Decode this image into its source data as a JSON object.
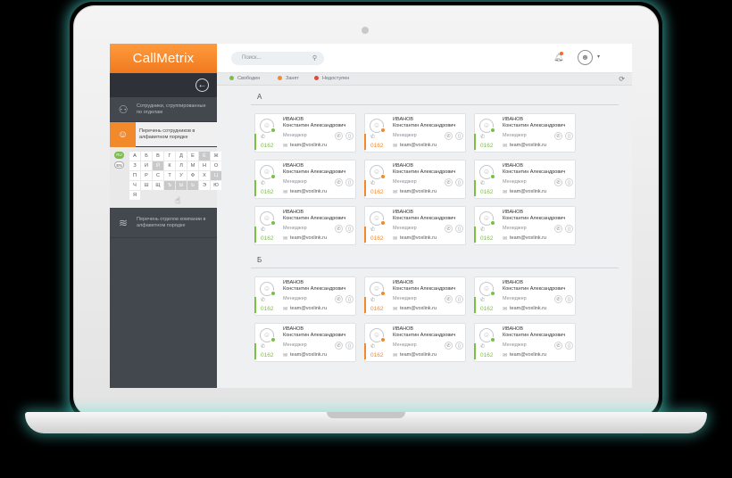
{
  "app": {
    "logo": "CallMetrix"
  },
  "colors": {
    "accent": "#f28a2c",
    "free": "#79c043",
    "busy": "#f28a2c",
    "unavailable": "#d94b3c"
  },
  "sidebar": {
    "back_icon": "arrow-left-icon",
    "items": [
      {
        "label": "Сотрудники, сгруппированные по отделам",
        "icon": "users-icon"
      },
      {
        "label": "Перечень сотрудников в алфавитном порядке",
        "icon": "user-list-icon"
      },
      {
        "label": "Перечень отделов компании в алфавитном порядке",
        "icon": "layers-icon"
      }
    ],
    "lang": {
      "ru": "RU",
      "en": "EN"
    },
    "letters": [
      "А",
      "Б",
      "В",
      "Г",
      "Д",
      "Е",
      "Ё",
      "Ж",
      "З",
      "И",
      "Й",
      "К",
      "Л",
      "М",
      "Н",
      "О",
      "П",
      "Р",
      "С",
      "Т",
      "У",
      "Ф",
      "Х",
      "Ц",
      "Ч",
      "Ш",
      "Щ",
      "Ъ",
      "Ы",
      "Ь",
      "Э",
      "Ю",
      "Я"
    ]
  },
  "topbar": {
    "search_placeholder": "Поиск..."
  },
  "statusbar": {
    "free": "Свободен",
    "busy": "Занят",
    "unavailable": "Недоступен"
  },
  "sections": [
    {
      "letter": "А",
      "cards": [
        {
          "surname": "ИВАНОВ",
          "name": "Константин Александрович",
          "role": "Менеджер",
          "email": "team@voxlink.ru",
          "ext": "0162",
          "status": "free"
        },
        {
          "surname": "ИВАНОВ",
          "name": "Константин Александрович",
          "role": "Менеджер",
          "email": "team@voxlink.ru",
          "ext": "0162",
          "status": "busy"
        },
        {
          "surname": "ИВАНОВ",
          "name": "Константин Александрович",
          "role": "Менеджер",
          "email": "team@voxlink.ru",
          "ext": "0162",
          "status": "free"
        },
        {
          "surname": "ИВАНОВ",
          "name": "Константин Александрович",
          "role": "Менеджер",
          "email": "team@voxlink.ru",
          "ext": "0162",
          "status": "free"
        },
        {
          "surname": "ИВАНОВ",
          "name": "Константин Александрович",
          "role": "Менеджер",
          "email": "team@voxlink.ru",
          "ext": "0162",
          "status": "busy"
        },
        {
          "surname": "ИВАНОВ",
          "name": "Константин Александрович",
          "role": "Менеджер",
          "email": "team@voxlink.ru",
          "ext": "0162",
          "status": "free"
        },
        {
          "surname": "ИВАНОВ",
          "name": "Константин Александрович",
          "role": "Менеджер",
          "email": "team@voxlink.ru",
          "ext": "0162",
          "status": "free"
        },
        {
          "surname": "ИВАНОВ",
          "name": "Константин Александрович",
          "role": "Менеджер",
          "email": "team@voxlink.ru",
          "ext": "0162",
          "status": "busy"
        },
        {
          "surname": "ИВАНОВ",
          "name": "Константин Александрович",
          "role": "Менеджер",
          "email": "team@voxlink.ru",
          "ext": "0162",
          "status": "free"
        }
      ]
    },
    {
      "letter": "Б",
      "cards": [
        {
          "surname": "ИВАНОВ",
          "name": "Константин Александрович",
          "role": "Менеджер",
          "email": "team@voxlink.ru",
          "ext": "0162",
          "status": "free"
        },
        {
          "surname": "ИВАНОВ",
          "name": "Константин Александрович",
          "role": "Менеджер",
          "email": "team@voxlink.ru",
          "ext": "0162",
          "status": "busy"
        },
        {
          "surname": "ИВАНОВ",
          "name": "Константин Александрович",
          "role": "Менеджер",
          "email": "team@voxlink.ru",
          "ext": "0162",
          "status": "free"
        },
        {
          "surname": "ИВАНОВ",
          "name": "Константин Александрович",
          "role": "Менеджер",
          "email": "team@voxlink.ru",
          "ext": "0162",
          "status": "free"
        },
        {
          "surname": "ИВАНОВ",
          "name": "Константин Александрович",
          "role": "Менеджер",
          "email": "team@voxlink.ru",
          "ext": "0162",
          "status": "busy"
        },
        {
          "surname": "ИВАНОВ",
          "name": "Константин Александрович",
          "role": "Менеджер",
          "email": "team@voxlink.ru",
          "ext": "0162",
          "status": "free"
        }
      ]
    }
  ]
}
